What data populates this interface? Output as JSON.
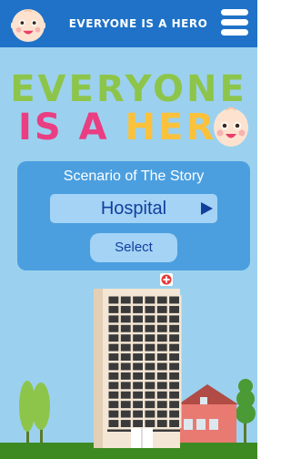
{
  "header": {
    "title": "EVERYONE IS A HERO",
    "avatar_icon": "baby-face-icon",
    "menu_icon": "hamburger-menu-icon",
    "bg_color": "#1f72c8"
  },
  "logo": {
    "line1": "EVERYONE",
    "line2_part1": "IS A",
    "line2_part2": "HER",
    "face_icon": "baby-face-icon"
  },
  "scenario": {
    "title": "Scenario of The Story",
    "selected": "Hospital",
    "select_label": "Select"
  },
  "scene": {
    "building": "hospital-building",
    "sign_icon": "medical-cross-icon",
    "house": "house",
    "trees": "trees"
  },
  "colors": {
    "sky": "#9bd1ee",
    "card": "#4b9fdf",
    "field": "#a4d3f6",
    "text_dark_blue": "#123f9c",
    "green": "#8dc54b",
    "pink": "#ea3e83",
    "yellow": "#fbc13b",
    "grass": "#3d8a22"
  }
}
